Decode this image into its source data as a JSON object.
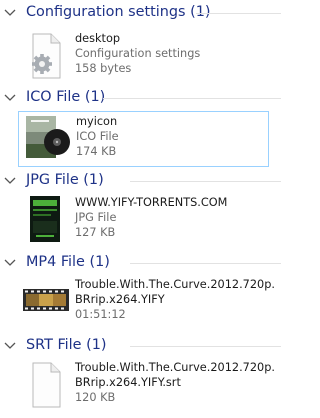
{
  "groups": [
    {
      "title": "Configuration settings (1)",
      "items": [
        {
          "name": "desktop",
          "type": "Configuration settings",
          "detail": "158 bytes"
        }
      ]
    },
    {
      "title": "ICO File (1)",
      "items": [
        {
          "name": "myicon",
          "type": "ICO File",
          "detail": "174 KB"
        }
      ]
    },
    {
      "title": "JPG File (1)",
      "items": [
        {
          "name": "WWW.YIFY-TORRENTS.COM",
          "type": "JPG File",
          "detail": "127 KB"
        }
      ]
    },
    {
      "title": "MP4 File (1)",
      "items": [
        {
          "name_line1": "Trouble.With.The.Curve.2012.720p.",
          "name_line2": "BRrip.x264.YIFY",
          "detail": "01:51:12"
        }
      ]
    },
    {
      "title": "SRT File (1)",
      "items": [
        {
          "name_line1": "Trouble.With.The.Curve.2012.720p.",
          "name_line2": "BRrip.x264.YIFY.srt",
          "detail": "120 KB"
        }
      ]
    }
  ],
  "icons": {
    "chevron": "chevron-down-icon",
    "config": "settings-file-icon",
    "ico": "image-thumbnail",
    "jpg": "image-thumbnail",
    "mp4": "video-thumbnail",
    "srt": "blank-document-icon"
  },
  "colors": {
    "group_title": "#1e3287",
    "selection_border": "#99d1ff",
    "muted_text": "#6d6d6d"
  }
}
